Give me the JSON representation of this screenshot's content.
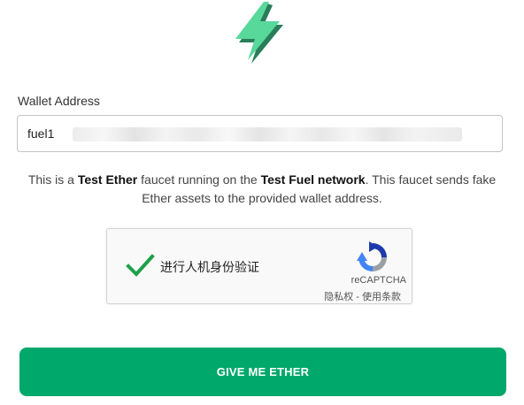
{
  "wallet": {
    "label": "Wallet Address",
    "value_visible": "fuel1"
  },
  "description": {
    "part1": "This is a ",
    "bold1": "Test Ether",
    "part2": " faucet running on the ",
    "bold2": "Test Fuel network",
    "part3": ". This faucet sends fake Ether assets to the provided wallet address."
  },
  "captcha": {
    "label": "进行人机身份验证",
    "brand": "reCAPTCHA",
    "links": "隐私权 - 使用条款",
    "checked": true
  },
  "submit": {
    "label": "GIVE ME ETHER"
  },
  "colors": {
    "brand_green": "#00a86b",
    "logo_green": "#58d89b",
    "check_green": "#1ea04a"
  },
  "icons": {
    "logo": "lightning-bolt-icon",
    "check": "checkmark-icon",
    "recaptcha": "recaptcha-icon"
  }
}
